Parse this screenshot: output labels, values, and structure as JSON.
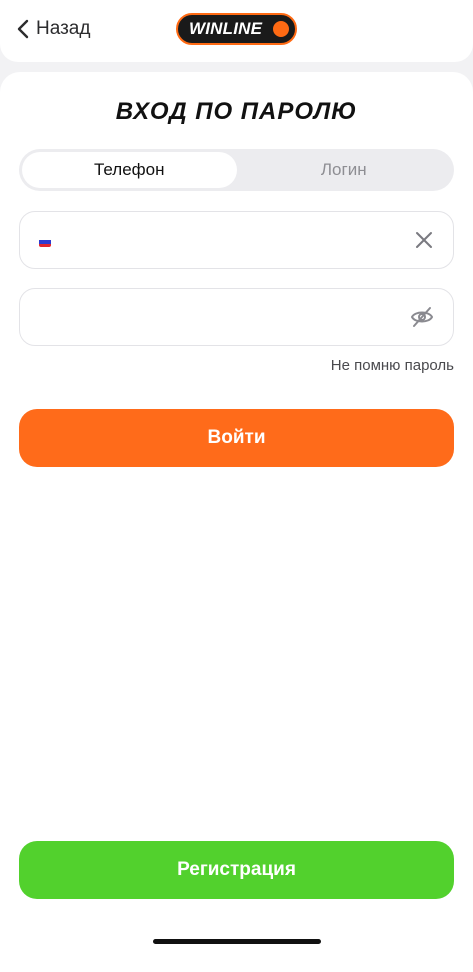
{
  "header": {
    "back_label": "Назад",
    "logo_text": "WINLINE",
    "brand_color": "#ff6a13"
  },
  "title": "ВХОД ПО ПАРОЛЮ",
  "tabs": [
    {
      "label": "Телефон",
      "active": true
    },
    {
      "label": "Логин",
      "active": false
    }
  ],
  "phone_field": {
    "value": "",
    "placeholder": "",
    "flag": "russia-flag-icon",
    "action_icon": "close-icon"
  },
  "password_field": {
    "value": "",
    "placeholder": "",
    "action_icon": "eye-off-icon"
  },
  "forgot_label": "Не помню пароль",
  "login_button": {
    "label": "Войти",
    "color": "#ff6b1a"
  },
  "register_button": {
    "label": "Регистрация",
    "color": "#52d12d"
  }
}
